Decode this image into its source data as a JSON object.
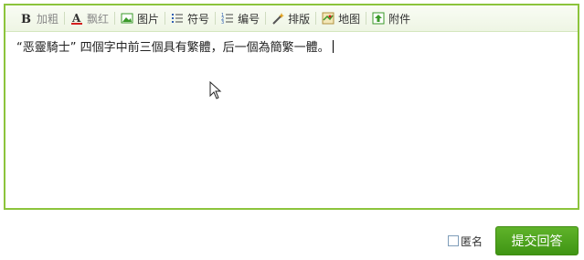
{
  "toolbar": {
    "items": [
      {
        "label": "加粗",
        "icon": "bold-icon"
      },
      {
        "label": "飘红",
        "icon": "red-text-icon"
      },
      {
        "label": "图片",
        "icon": "image-icon"
      },
      {
        "label": "符号",
        "icon": "bullet-list-icon"
      },
      {
        "label": "编号",
        "icon": "numbered-list-icon"
      },
      {
        "label": "排版",
        "icon": "format-wand-icon"
      },
      {
        "label": "地图",
        "icon": "map-icon"
      },
      {
        "label": "附件",
        "icon": "attachment-upload-icon"
      }
    ]
  },
  "editor": {
    "text": "“恶靈騎士” 四個字中前三個具有繁體，后一個為簡繁一體。"
  },
  "footer": {
    "anonymous_label": "匿名",
    "submit_label": "提交回答"
  },
  "colors": {
    "border": "#8cc43c",
    "submit_bg": "#4ca21f",
    "icon_green": "#3a9a2a",
    "icon_blue": "#2f5fb3"
  }
}
